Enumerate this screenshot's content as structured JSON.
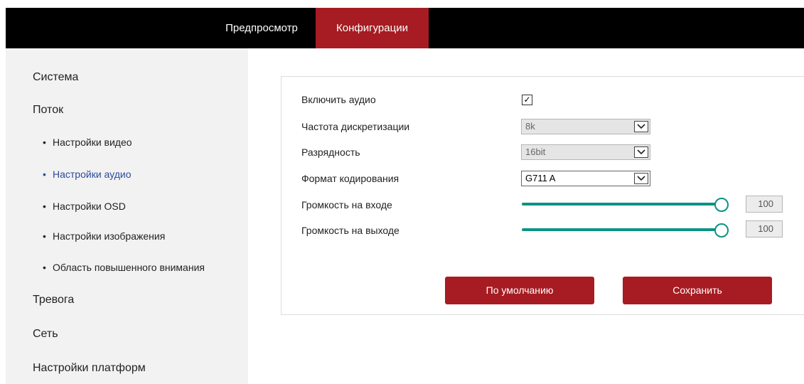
{
  "header": {
    "tabs": [
      {
        "label": "Предпросмотр",
        "active": false
      },
      {
        "label": "Конфигурации",
        "active": true
      }
    ],
    "accent_color": "#a61c22"
  },
  "sidebar": {
    "sections": [
      {
        "label": "Система"
      },
      {
        "label": "Поток"
      },
      {
        "label": "Тревога"
      },
      {
        "label": "Сеть"
      },
      {
        "label": "Настройки платформ"
      }
    ],
    "subitems": [
      {
        "label": "Настройки видео",
        "active": false
      },
      {
        "label": "Настройки аудио",
        "active": true
      },
      {
        "label": "Настройки OSD",
        "active": false
      },
      {
        "label": "Настройки изображения",
        "active": false
      },
      {
        "label": "Область повышенного внимания",
        "active": false
      }
    ],
    "bullet": "•",
    "active_color": "#2d4a9a"
  },
  "audio_settings": {
    "enable_audio": {
      "label": "Включить аудио",
      "checked": true,
      "check_glyph": "✓"
    },
    "sample_rate": {
      "label": "Частота дискретизации",
      "value": "8k",
      "disabled": true
    },
    "bit_depth": {
      "label": "Разрядность",
      "value": "16bit",
      "disabled": true
    },
    "encoding": {
      "label": "Формат кодирования",
      "value": "G711 A",
      "disabled": false
    },
    "input_volume": {
      "label": "Громкость на входе",
      "value": "100",
      "level": 100
    },
    "output_volume": {
      "label": "Громкость на выходе",
      "value": "100",
      "level": 100
    },
    "slider_color": "#0b9383"
  },
  "actions": {
    "default_label": "По умолчанию",
    "save_label": "Сохранить"
  }
}
